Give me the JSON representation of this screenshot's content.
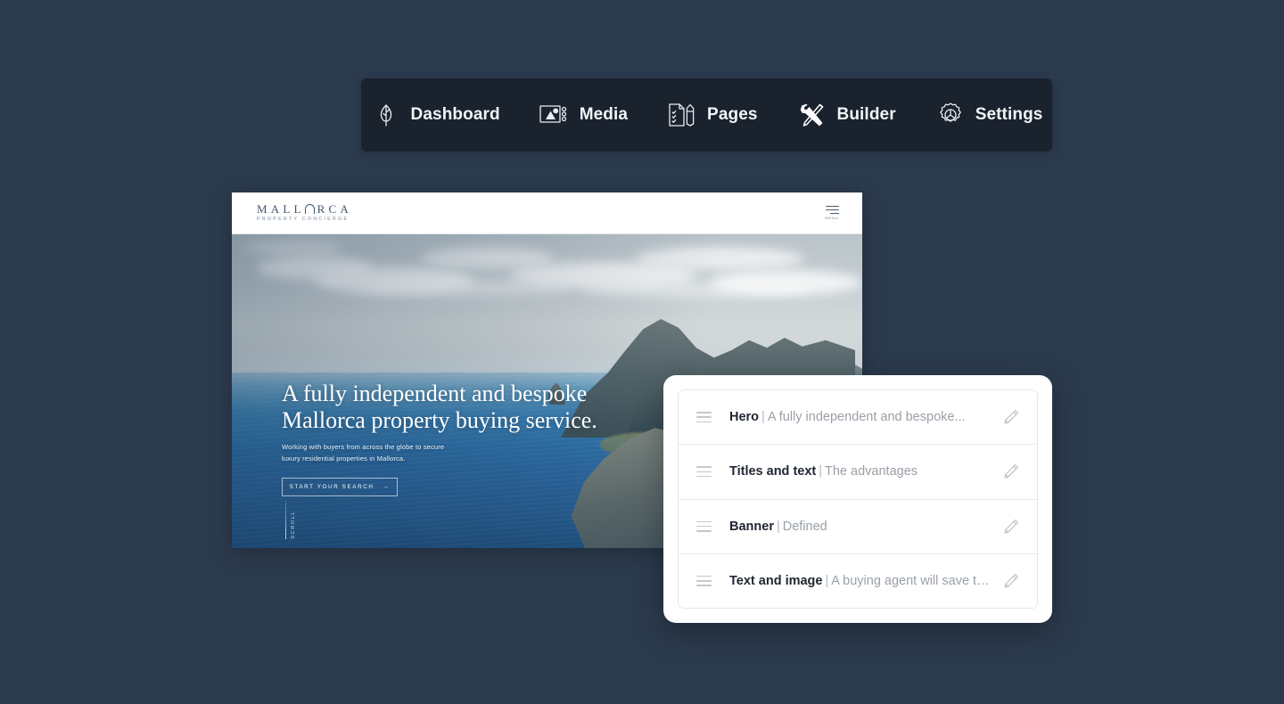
{
  "background_color": "#2b3a4d",
  "navbar": {
    "background_color": "#1a222e",
    "items": [
      {
        "label": "Dashboard",
        "icon": "leaf-icon"
      },
      {
        "label": "Media",
        "icon": "image-gallery-icon"
      },
      {
        "label": "Pages",
        "icon": "document-pencil-icon"
      },
      {
        "label": "Builder",
        "icon": "wrench-screwdriver-icon"
      },
      {
        "label": "Settings",
        "icon": "gear-icon"
      }
    ]
  },
  "site_preview": {
    "logo": {
      "brand_before": "MALL",
      "brand_after": "RCA",
      "tagline": "PROPERTY  CONCIERGE"
    },
    "menu": {
      "label": "MENU",
      "icon": "hamburger-menu-icon"
    },
    "hero": {
      "title_line1": "A fully independent and bespoke",
      "title_line2": "Mallorca property buying service.",
      "subtitle_line1": "Working with buyers from across the globe to secure",
      "subtitle_line2": "luxury residential properties in Mallorca.",
      "cta_label": "START YOUR SEARCH",
      "cta_arrow": "→",
      "scroll_label": "SCROLL"
    }
  },
  "builder_panel": {
    "blocks": [
      {
        "title": "Hero",
        "separator": "|",
        "description": "A fully independent and bespoke...",
        "edit_icon": "pencil-icon"
      },
      {
        "title": "Titles and text",
        "separator": "|",
        "description": "The advantages",
        "edit_icon": "pencil-icon"
      },
      {
        "title": "Banner",
        "separator": "|",
        "description": "Defined",
        "edit_icon": "pencil-icon"
      },
      {
        "title": "Text and image",
        "separator": "|",
        "description": "A buying agent will save time",
        "edit_icon": "pencil-icon"
      }
    ]
  }
}
